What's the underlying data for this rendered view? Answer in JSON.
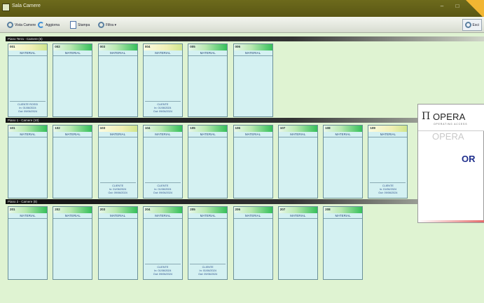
{
  "window": {
    "title": "Sala Camere",
    "minimize_glyph": "–",
    "maximize_glyph": "□"
  },
  "toolbar": {
    "new_label": "Vista Camere",
    "refresh_label": "Aggiorna",
    "print_label": "Stampa",
    "filter_label": "Filtra ▾",
    "right_label": "Esci"
  },
  "sections": [
    {
      "title": "Piano Terra - Camere (6)",
      "rooms": [
        {
          "num": "001",
          "status": "yellow",
          "label": "MATERIAL",
          "info": [
            "CLIENTE ROSSI",
            "In: 01/06/2024",
            "Out: 09/06/2024"
          ]
        },
        {
          "num": "002",
          "status": "green",
          "label": "MATERIAL",
          "info": []
        },
        {
          "num": "003",
          "status": "green",
          "label": "MATERIAL",
          "info": []
        },
        {
          "num": "004",
          "status": "yellow",
          "label": "MATERIAL",
          "info": [
            "CLIENTE",
            "In: 01/06/2024",
            "Out: 09/06/2024"
          ]
        },
        {
          "num": "005",
          "status": "green",
          "label": "MATERIAL",
          "info": []
        },
        {
          "num": "006",
          "status": "green",
          "label": "MATERIAL",
          "info": []
        }
      ]
    },
    {
      "title": "Piano 1 - Camere (10)",
      "rooms": [
        {
          "num": "101",
          "status": "green",
          "label": "MATERIAL",
          "info": []
        },
        {
          "num": "102",
          "status": "green",
          "label": "MATERIAL",
          "info": []
        },
        {
          "num": "103",
          "status": "yellow",
          "label": "MATERIAL",
          "info": [
            "CLIENTE",
            "In: 01/06/2024",
            "Out: 09/06/2024"
          ]
        },
        {
          "num": "104",
          "status": "green",
          "label": "MATERIAL",
          "info": [
            "CLIENTE",
            "In: 01/06/2024",
            "Out: 09/06/2024"
          ]
        },
        {
          "num": "105",
          "status": "green",
          "label": "MATERIAL",
          "info": []
        },
        {
          "num": "106",
          "status": "green",
          "label": "MATERIAL",
          "info": []
        },
        {
          "num": "107",
          "status": "green",
          "label": "MATERIAL",
          "info": []
        },
        {
          "num": "108",
          "status": "green",
          "label": "MATERIAL",
          "info": []
        },
        {
          "num": "109",
          "status": "yellow",
          "label": "MATERIAL",
          "info": [
            "CLIENTE",
            "In: 01/06/2024",
            "Out: 09/06/2024"
          ]
        }
      ]
    },
    {
      "title": "Piano 2 - Camere (8)",
      "rooms": [
        {
          "num": "201",
          "status": "green",
          "label": "MATERIAL",
          "info": []
        },
        {
          "num": "202",
          "status": "green",
          "label": "MATERIAL",
          "info": []
        },
        {
          "num": "203",
          "status": "green",
          "label": "MATERIAL",
          "info": []
        },
        {
          "num": "204",
          "status": "green",
          "label": "MATERIAL",
          "info": [
            "CLIENTE",
            "In: 01/06/2024",
            "Out: 09/06/2024"
          ]
        },
        {
          "num": "205",
          "status": "green",
          "label": "MATERIAL",
          "info": [
            "CLIENTE",
            "In: 01/06/2024",
            "Out: 09/06/2024"
          ]
        },
        {
          "num": "206",
          "status": "green",
          "label": "MATERIAL",
          "info": []
        },
        {
          "num": "207",
          "status": "green",
          "label": "MATERIAL",
          "info": []
        },
        {
          "num": "208",
          "status": "green",
          "label": "MATERIAL",
          "info": []
        }
      ]
    }
  ],
  "overlay": {
    "logo_mark": "Π",
    "logo_text": "OPERA",
    "logo_tagline": "OPERATING ACCESS",
    "ghost_text": "OPERA",
    "brand_text": "OR"
  },
  "colors": {
    "titlebar": "#6d6a1c",
    "background": "#dff3d2",
    "card_body": "#d4f1f2",
    "status_free": "#36c05a",
    "status_occupied": "#f0f0b5",
    "brand_blue": "#1f2f8c"
  }
}
